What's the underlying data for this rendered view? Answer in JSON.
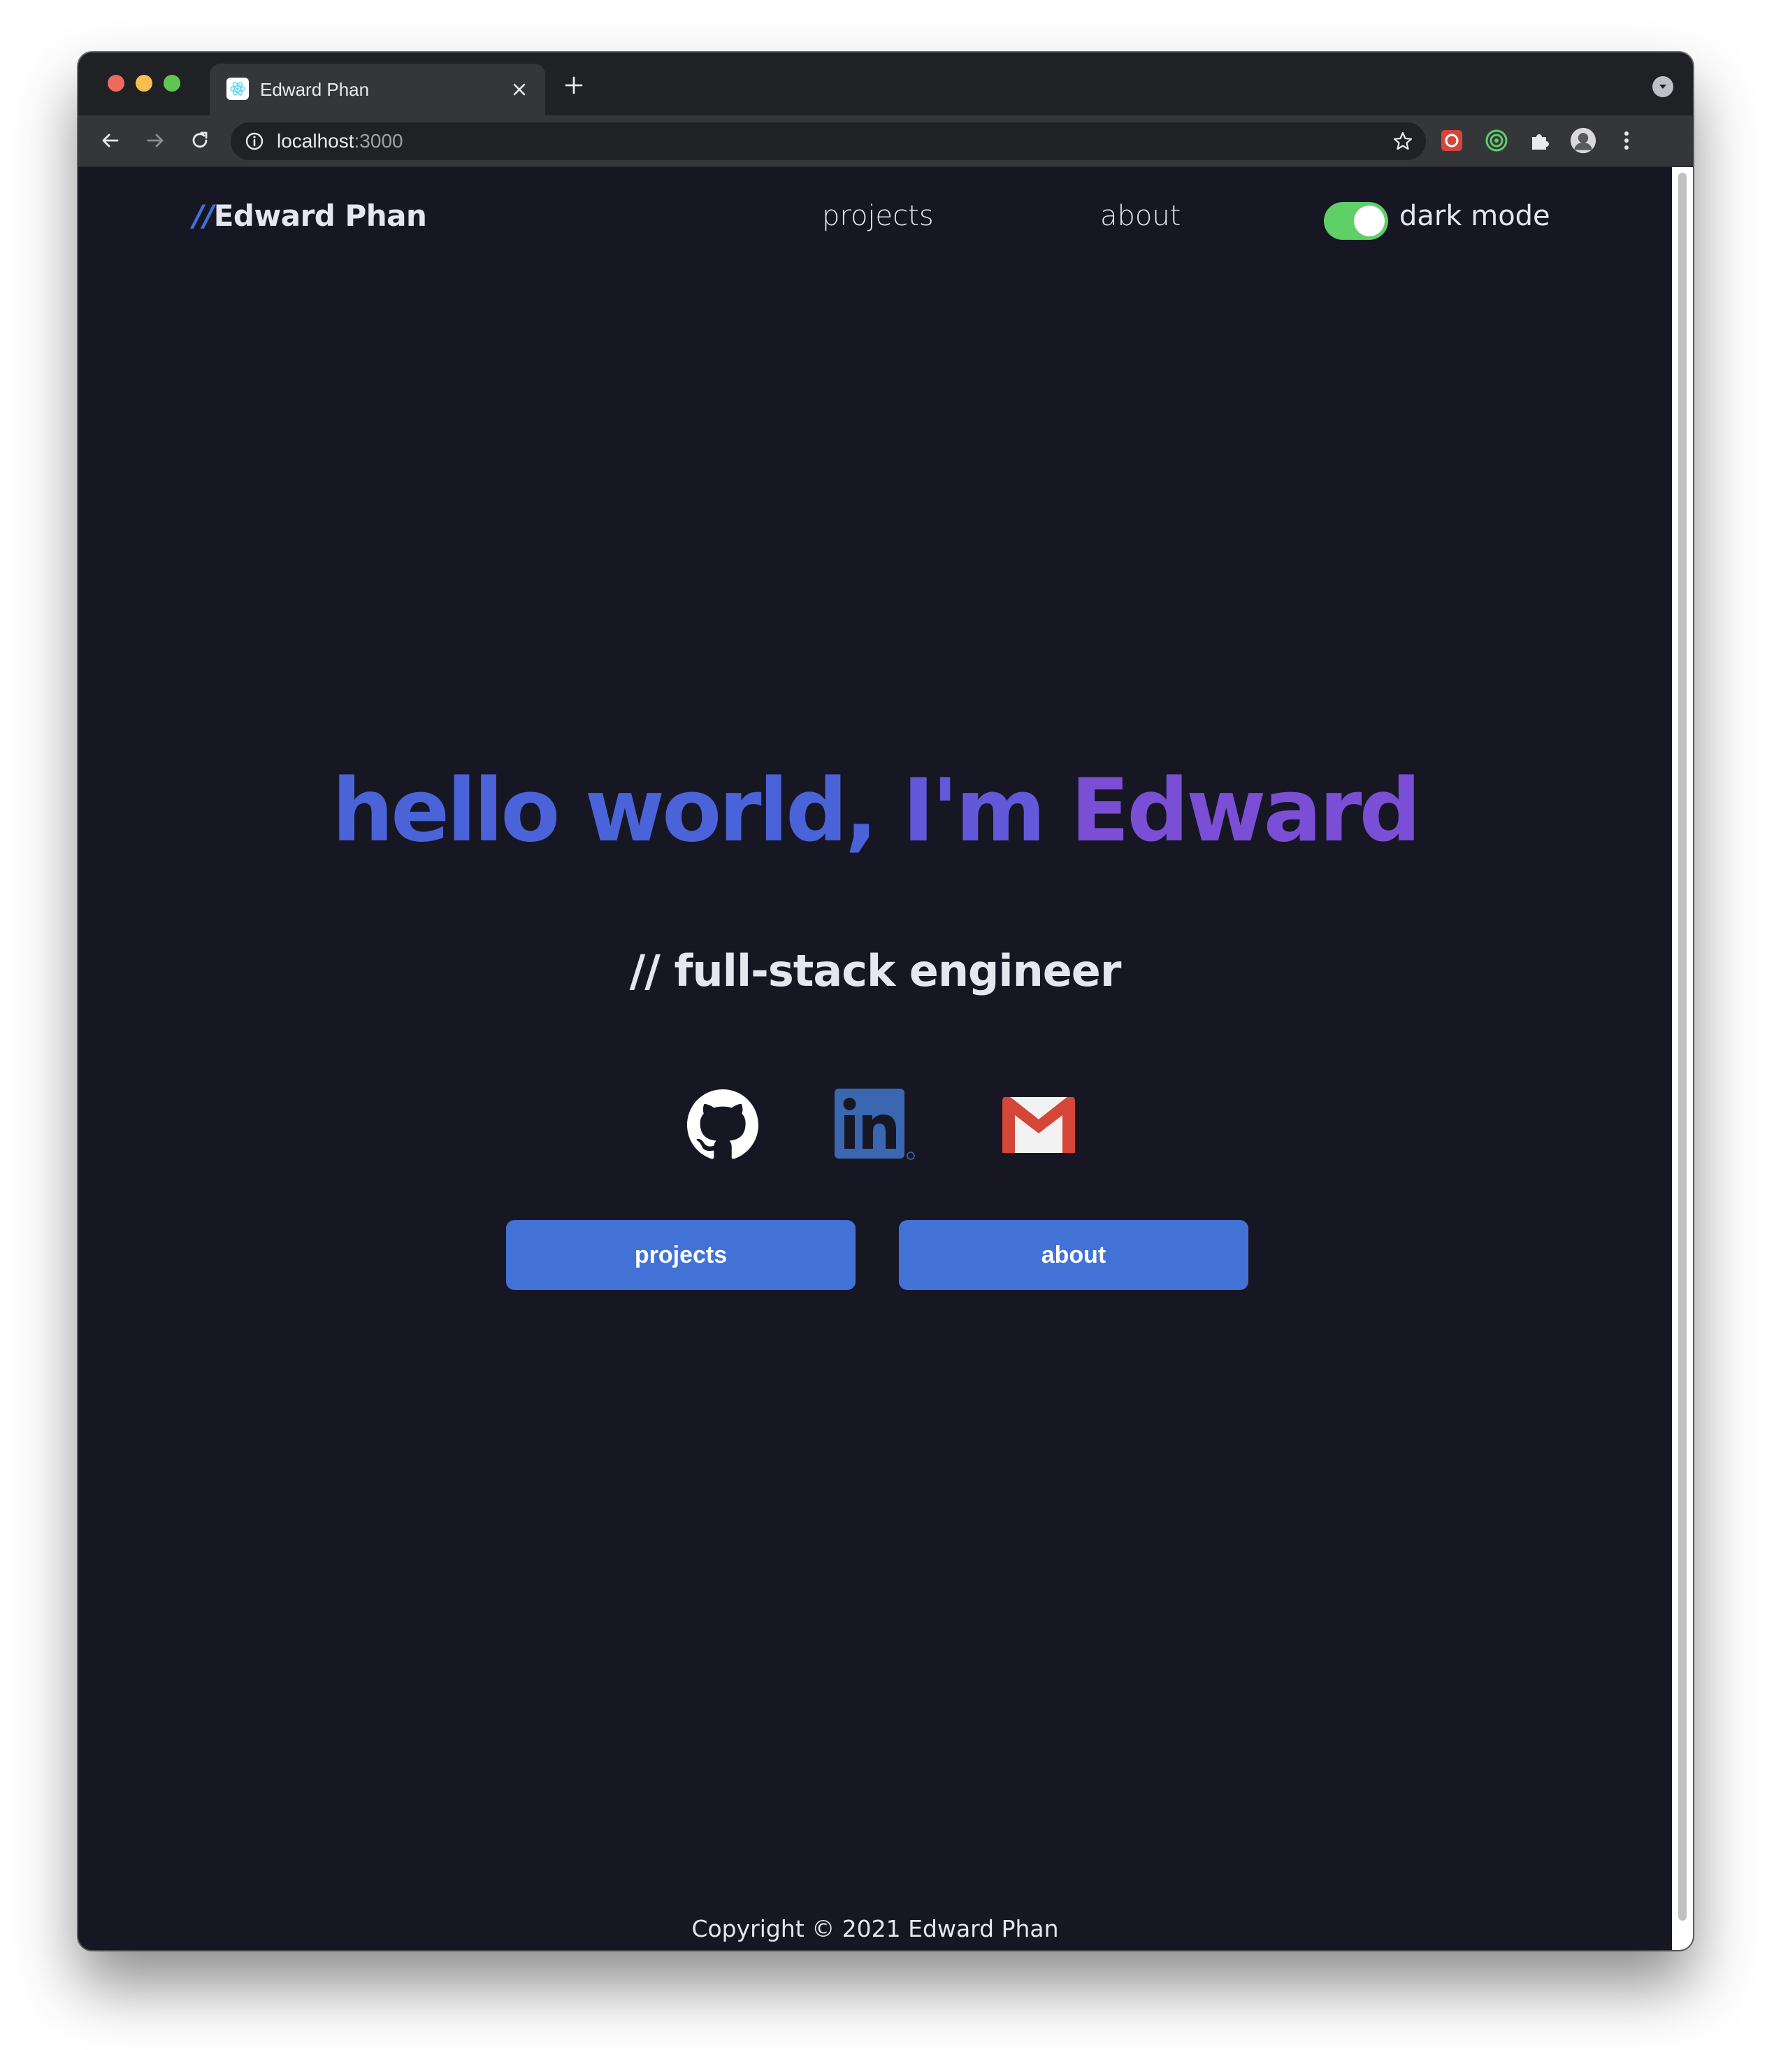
{
  "browser": {
    "tab_title": "Edward Phan",
    "url_host": "localhost",
    "url_port": ":3000",
    "icons": [
      "back-icon",
      "forward-icon",
      "reload-icon",
      "info-icon",
      "star-icon",
      "extension-icon",
      "puzzle-icon",
      "profile-avatar",
      "kebab-menu-icon"
    ]
  },
  "nav": {
    "brand_slashes": "//",
    "brand_name": "Edward Phan",
    "links": [
      "projects",
      "about"
    ],
    "dark_mode_label": "dark mode",
    "dark_mode_on": true
  },
  "hero": {
    "title_part1": "hello world,",
    "title_part2": "I'm",
    "title_part3": "Edward",
    "subtitle": "// full-stack engineer",
    "social": [
      "github-icon",
      "linkedin-icon",
      "gmail-icon"
    ],
    "buttons": [
      "projects",
      "about"
    ]
  },
  "footer": {
    "copyright": "Copyright © 2021 Edward Phan"
  },
  "colors": {
    "page_bg": "#171724",
    "accent_blue": "#4372d6",
    "title_gradient_start": "#4b63d9",
    "title_gradient_end": "#7a4fd6",
    "toggle_green": "#5fcf67"
  }
}
